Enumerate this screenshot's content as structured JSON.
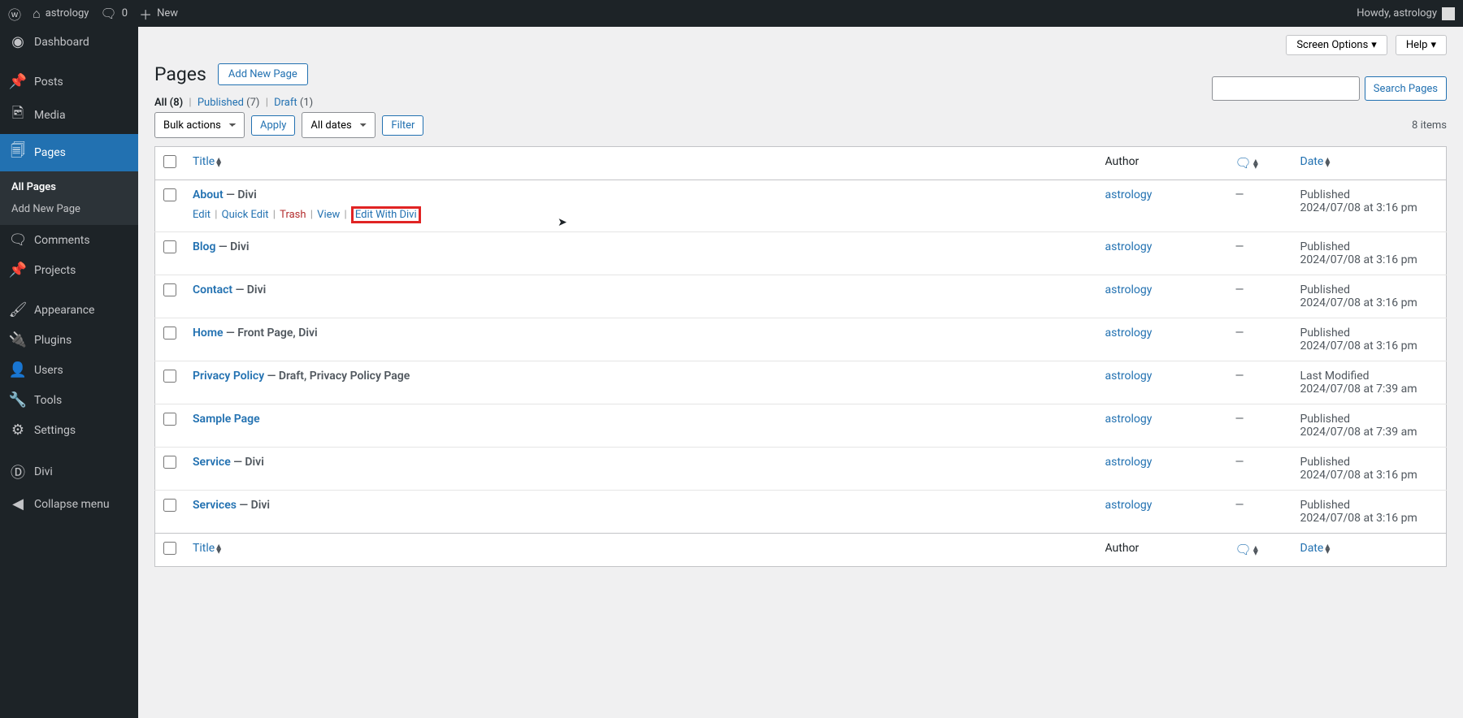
{
  "adminbar": {
    "site_name": "astrology",
    "comments_count": "0",
    "new_label": "New",
    "greeting": "Howdy, astrology"
  },
  "sidebar": {
    "items": [
      {
        "label": "Dashboard"
      },
      {
        "label": "Posts"
      },
      {
        "label": "Media"
      },
      {
        "label": "Pages"
      },
      {
        "label": "Comments"
      },
      {
        "label": "Projects"
      },
      {
        "label": "Appearance"
      },
      {
        "label": "Plugins"
      },
      {
        "label": "Users"
      },
      {
        "label": "Tools"
      },
      {
        "label": "Settings"
      },
      {
        "label": "Divi"
      },
      {
        "label": "Collapse menu"
      }
    ],
    "sub": {
      "all_pages": "All Pages",
      "add_new": "Add New Page"
    }
  },
  "screen_options": "Screen Options",
  "help": "Help",
  "page_title": "Pages",
  "add_new_btn": "Add New Page",
  "filters": {
    "all_label": "All",
    "all_count": "(8)",
    "published_label": "Published",
    "published_count": "(7)",
    "draft_label": "Draft",
    "draft_count": "(1)"
  },
  "search_btn": "Search Pages",
  "bulk_actions": "Bulk actions",
  "apply_btn": "Apply",
  "all_dates": "All dates",
  "filter_btn": "Filter",
  "items_count": "8 items",
  "columns": {
    "title": "Title",
    "author": "Author",
    "date": "Date"
  },
  "row_actions": {
    "edit": "Edit",
    "quick_edit": "Quick Edit",
    "trash": "Trash",
    "view": "View",
    "edit_divi": "Edit With Divi"
  },
  "rows": [
    {
      "title": "About",
      "suffix": " — Divi",
      "author": "astrology",
      "comments": "—",
      "status": "Published",
      "date": "2024/07/08 at 3:16 pm",
      "show_actions": true
    },
    {
      "title": "Blog",
      "suffix": " — Divi",
      "author": "astrology",
      "comments": "—",
      "status": "Published",
      "date": "2024/07/08 at 3:16 pm"
    },
    {
      "title": "Contact",
      "suffix": " — Divi",
      "author": "astrology",
      "comments": "—",
      "status": "Published",
      "date": "2024/07/08 at 3:16 pm"
    },
    {
      "title": "Home",
      "suffix": " — Front Page, Divi",
      "author": "astrology",
      "comments": "—",
      "status": "Published",
      "date": "2024/07/08 at 3:16 pm"
    },
    {
      "title": "Privacy Policy",
      "suffix": " — Draft, Privacy Policy Page",
      "author": "astrology",
      "comments": "—",
      "status": "Last Modified",
      "date": "2024/07/08 at 7:39 am"
    },
    {
      "title": "Sample Page",
      "suffix": "",
      "author": "astrology",
      "comments": "—",
      "status": "Published",
      "date": "2024/07/08 at 7:39 am"
    },
    {
      "title": "Service",
      "suffix": " — Divi",
      "author": "astrology",
      "comments": "—",
      "status": "Published",
      "date": "2024/07/08 at 3:16 pm"
    },
    {
      "title": "Services",
      "suffix": " — Divi",
      "author": "astrology",
      "comments": "—",
      "status": "Published",
      "date": "2024/07/08 at 3:16 pm"
    }
  ]
}
